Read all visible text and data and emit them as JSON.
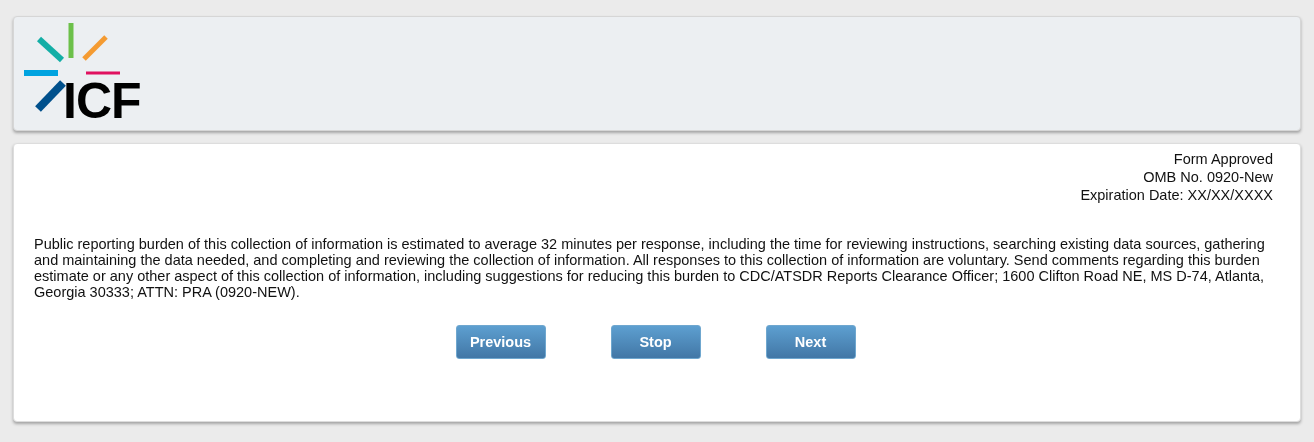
{
  "header": {
    "logo_text": "ICF"
  },
  "approval": [
    "Form Approved",
    "OMB No. 0920-New",
    "Expiration Date: XX/XX/XXXX"
  ],
  "burden_statement": "Public reporting burden of this collection of information is estimated to average 32 minutes per response, including the time for reviewing instructions, searching existing data sources, gathering and maintaining the data needed, and completing and reviewing the collection of information. All responses to this collection of information are voluntary. Send comments regarding this burden estimate or any other aspect of this collection of information, including suggestions for reducing this burden to CDC/ATSDR Reports Clearance Officer; 1600 Clifton Road NE, MS D-74, Atlanta, Georgia 30333; ATTN: PRA (0920-NEW).",
  "buttons": [
    "Previous",
    "Stop",
    "Next"
  ]
}
